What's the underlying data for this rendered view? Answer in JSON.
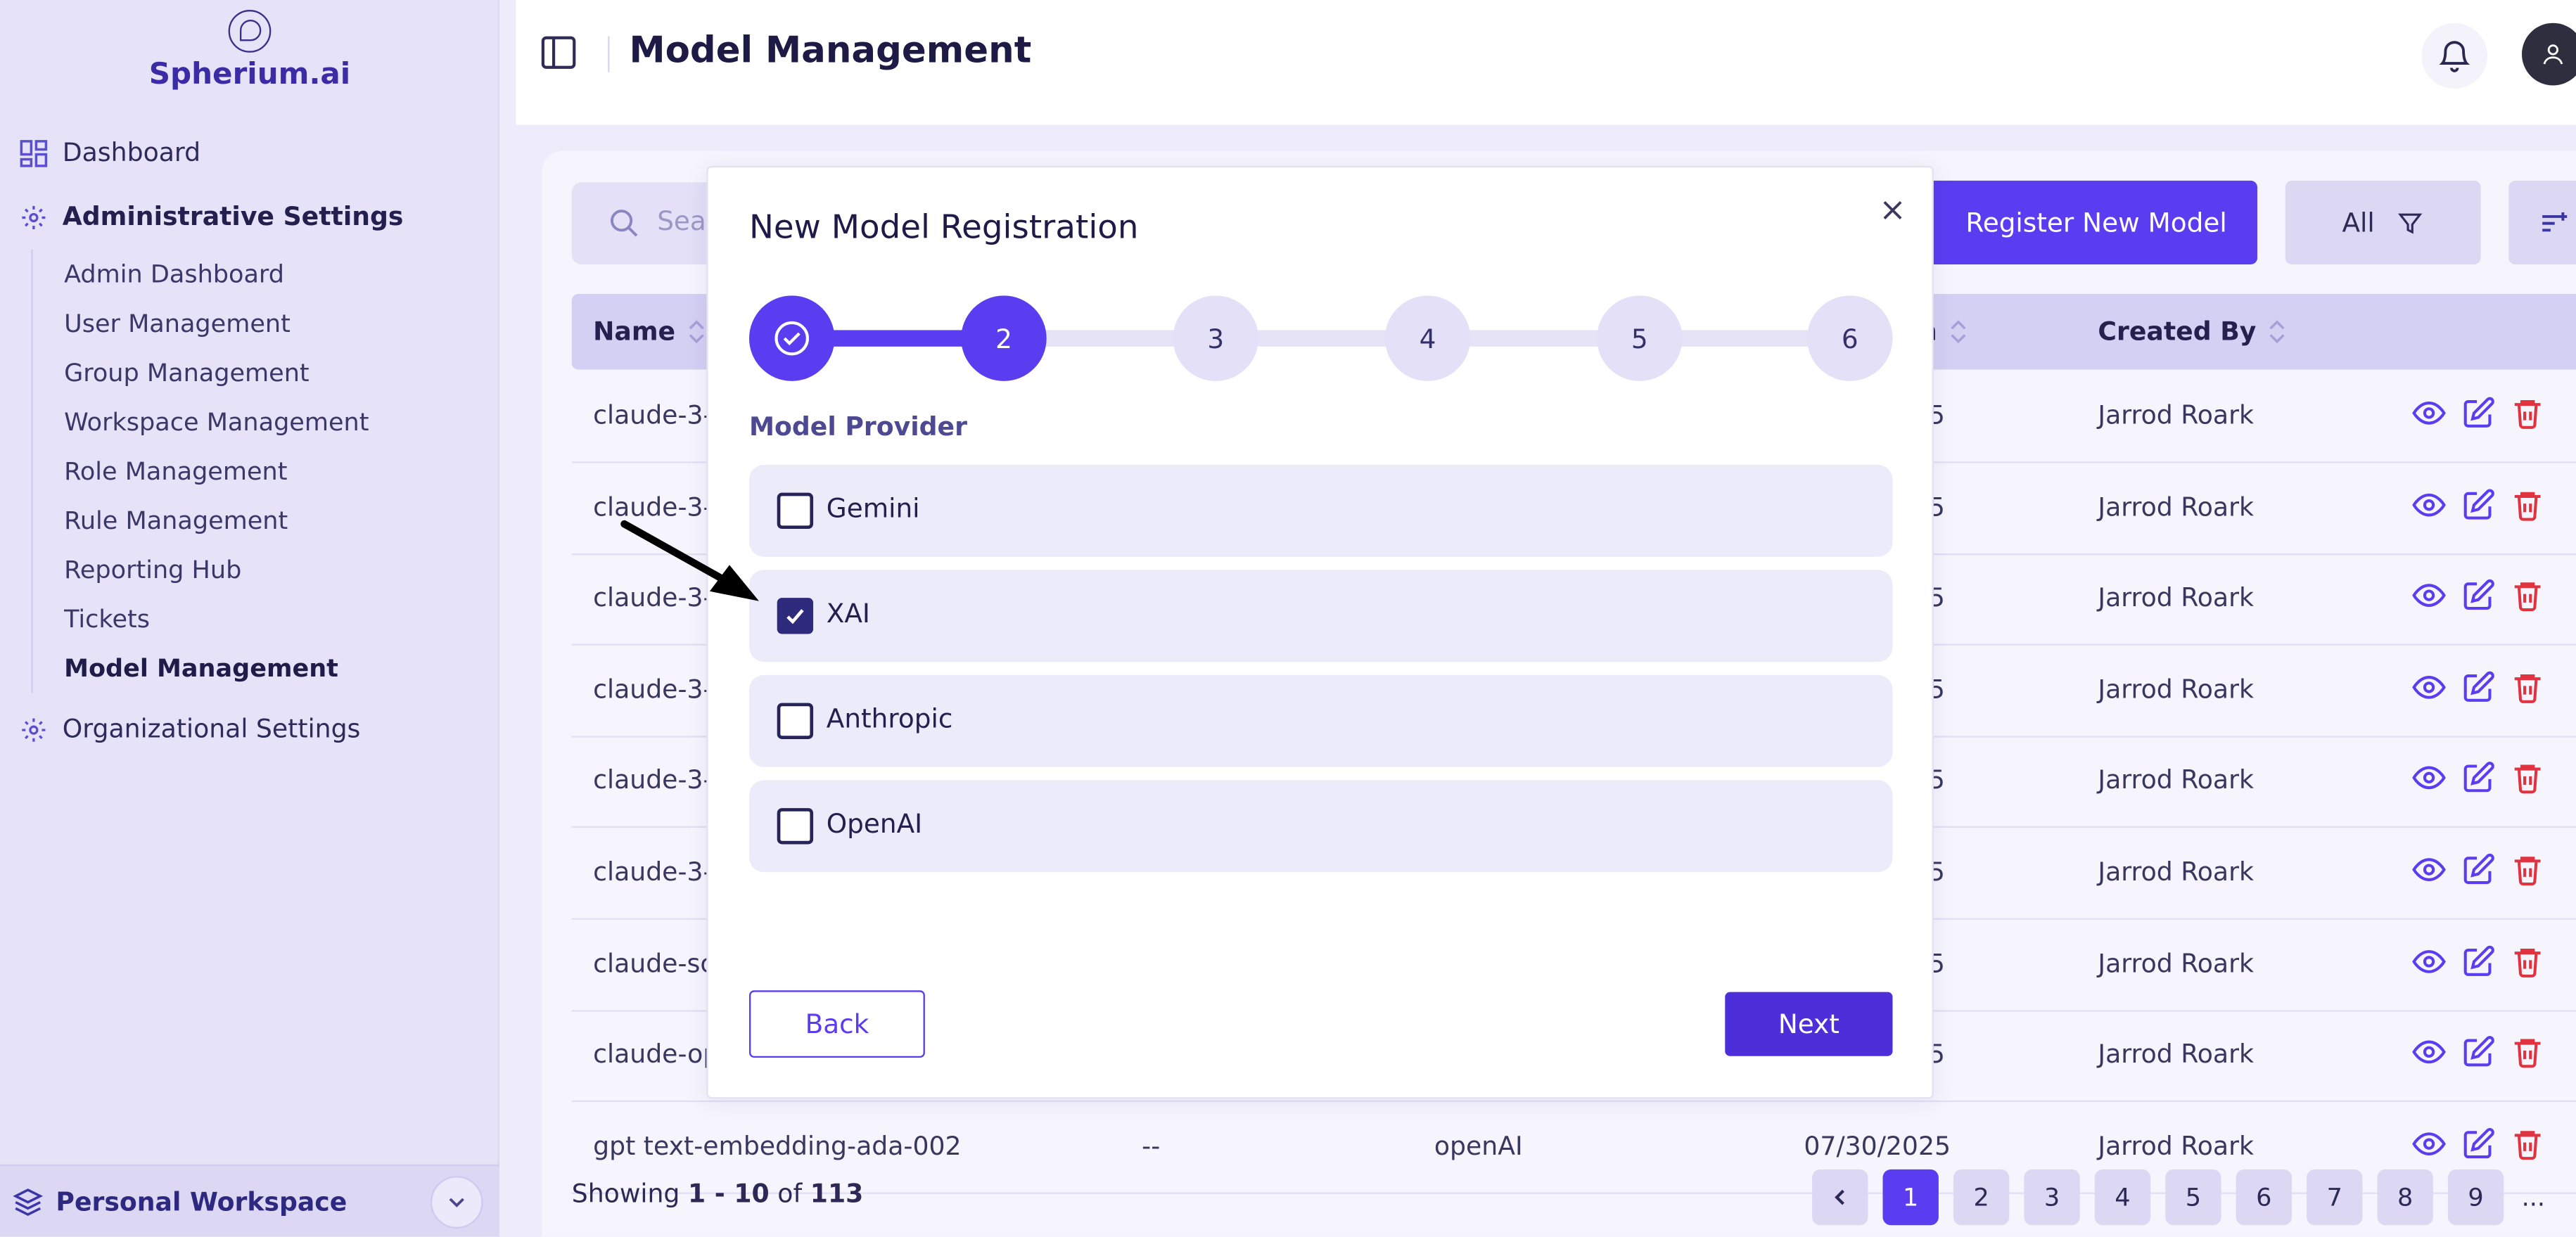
{
  "app": {
    "logo_text": "Spherium.ai"
  },
  "sidebar": {
    "dashboard": "Dashboard",
    "admin_settings": "Administrative Settings",
    "admin_items": [
      {
        "label": "Admin Dashboard"
      },
      {
        "label": "User Management"
      },
      {
        "label": "Group Management"
      },
      {
        "label": "Workspace Management"
      },
      {
        "label": "Role Management"
      },
      {
        "label": "Rule Management"
      },
      {
        "label": "Reporting Hub"
      },
      {
        "label": "Tickets"
      },
      {
        "label": "Model Management"
      }
    ],
    "org_settings": "Organizational Settings",
    "workspace": "Personal Workspace"
  },
  "header": {
    "title": "Model Management"
  },
  "toolbar": {
    "search_placeholder": "Sear",
    "register_label": "Register New Model",
    "filter_label": "All"
  },
  "table": {
    "headers": {
      "name": "Name",
      "col_date_partial": "n",
      "created_by": "Created By"
    },
    "rows": [
      {
        "name": "claude-3-",
        "date": "5",
        "created_by": "Jarrod Roark"
      },
      {
        "name": "claude-3-",
        "date": "5",
        "created_by": "Jarrod Roark"
      },
      {
        "name": "claude-3-",
        "date": "5",
        "created_by": "Jarrod Roark"
      },
      {
        "name": "claude-3-",
        "date": "5",
        "created_by": "Jarrod Roark"
      },
      {
        "name": "claude-3-",
        "date": "5",
        "created_by": "Jarrod Roark"
      },
      {
        "name": "claude-3-",
        "date": "5",
        "created_by": "Jarrod Roark"
      },
      {
        "name": "claude-sc",
        "date": "5",
        "created_by": "Jarrod Roark"
      },
      {
        "name": "claude-op",
        "date": "5",
        "created_by": "Jarrod Roark"
      },
      {
        "name": "gpt text-embedding-ada-002",
        "col2": "--",
        "col3": "openAI",
        "date": "07/30/2025",
        "created_by": "Jarrod Roark"
      }
    ]
  },
  "footer": {
    "showing_prefix": "Showing",
    "range": "1 - 10",
    "of_label": "of",
    "total": "113",
    "pages": [
      "1",
      "2",
      "3",
      "4",
      "5",
      "6",
      "7",
      "8",
      "9"
    ],
    "ellipsis": "..."
  },
  "modal": {
    "title": "New Model Registration",
    "steps": [
      "1",
      "2",
      "3",
      "4",
      "5",
      "6"
    ],
    "section_label": "Model Provider",
    "options": [
      {
        "label": "Gemini",
        "checked": false
      },
      {
        "label": "XAI",
        "checked": true
      },
      {
        "label": "Anthropic",
        "checked": false
      },
      {
        "label": "OpenAI",
        "checked": false
      }
    ],
    "back_label": "Back",
    "next_label": "Next"
  },
  "colors": {
    "accent": "#5a3df0",
    "sidebar_bg": "#e6e3f8",
    "danger": "#e0323f"
  }
}
